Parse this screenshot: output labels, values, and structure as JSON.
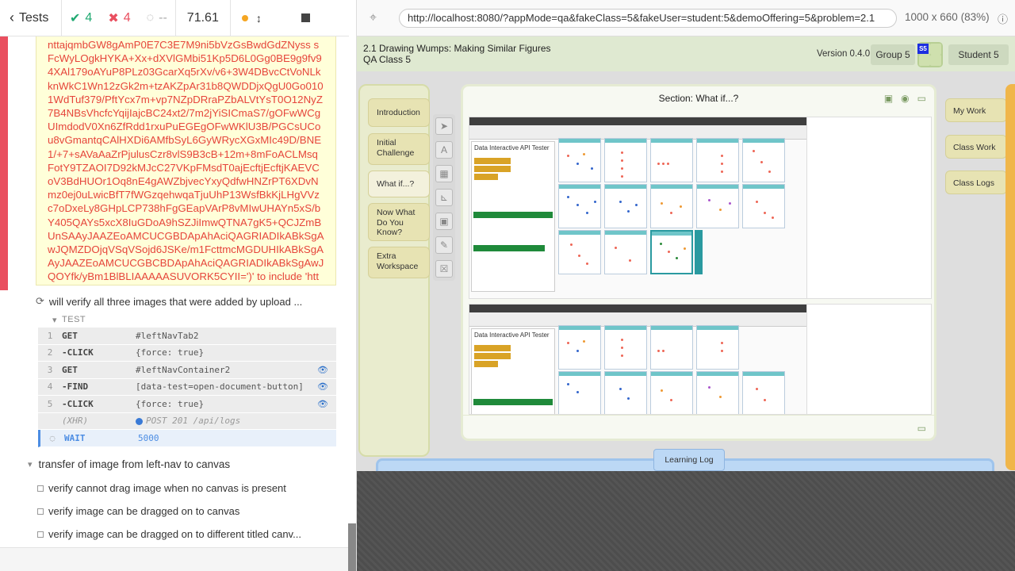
{
  "runner": {
    "tests_label": "Tests",
    "passed": "4",
    "failed": "4",
    "pending": "--",
    "duration": "71.61",
    "error_text": "nttajqmbGW8gAmP0E7C3E7M9ni5bVzGsBwdGdZNyss sFcWyLOgkHYKA+Xx+dXVlGMbi51Kp5D6L0Gg0BE9g9fv94XAl179oAYuP8PLz03GcarXq5rXv/v6+3W4DBvcCtVoNLkknWkC1Wn12zGk2m+tzAKZpAr31b8QWDDjxQgU0Go0101WdTuf379/PftYcx7m+vp7NZpDRraPZbALVtYsT0O12NyZ7B4NBsVhcfcYqijIajcBC24xt2/7m2jYiSICmaS7/gOFwWCgUImdodV0Xn6ZfRdd1rxuPuEGEgOFwWKlU3B/PGCsUCou8vGmantqCAlHXDi6AMfbSyL6GyWRycXGxMIc49D/BNE1/+7+sAVaAaZrPjulusCzr8vlS9B3cB+12m+8mFoACLMsqFotY9TZAOI7D92kMJcC27VKpFMsdT0ajEcftjEcftjKAEVCoV3BdHUOr1Oq8nE4gAWZbjvecYxyQdfwHNZrPT6XDvNmz0ej0uLwicBfT7fWGzqehwqaTjuUhP13WsfBkKjLHgVVzc7oDxeLy8GHpLCP738hFgGEapVArP8vMIwUHAYn5xS/bY405QAYs5xcX8IuGDoA9hSZJiImwQTNA7gK5+QCJZmBUnSAAyJAAZEoAMCUCGBDApAhAciQAGRIADIkABkSgAwJQMZDOjqVSqVSojd6JSKe/m1FcttmcMGDUHIkABkSgAAyJAAZEoAMCUCGBCBDApAhAciQAGRIADIkABkSgAwJQOYfk/yBm1BlBLIAAAAASUVORK5CYII=')' to include 'https://codap.concord.org/~eireland/image.png'",
    "current_test": "will verify all three images that were added by upload ...",
    "test_header": "TEST",
    "commands": [
      {
        "n": "1",
        "name": "GET",
        "msg": "#leftNavTab2"
      },
      {
        "n": "2",
        "name": "-CLICK",
        "msg": "{force: true}"
      },
      {
        "n": "3",
        "name": "GET",
        "msg": "#leftNavContainer2"
      },
      {
        "n": "4",
        "name": "-FIND",
        "msg": "[data-test=open-document-button]"
      },
      {
        "n": "5",
        "name": "-CLICK",
        "msg": "{force: true}"
      },
      {
        "n": "",
        "name": "(XHR)",
        "msg": "POST 201 /api/logs"
      },
      {
        "n": "",
        "name": "WAIT",
        "msg": "5000"
      }
    ],
    "suite_title": "transfer of image from left-nav to canvas",
    "tests": [
      "verify cannot drag image when no canvas is present",
      "verify image can be dragged on to canvas",
      "verify image can be dragged on to different titled canv..."
    ]
  },
  "aut": {
    "url": "http://localhost:8080/?appMode=qa&fakeClass=5&fakeUser=student:5&demoOffering=5&problem=2.1",
    "viewport": "1000 x 660",
    "scale": "(83%)"
  },
  "app": {
    "title_line1": "2.1 Drawing Wumps: Making Similar Figures",
    "title_line2": "QA Class 5",
    "version": "Version 0.4.0",
    "group": "Group 5",
    "badge": "S5",
    "student": "Student 5",
    "left_tabs": [
      "Introduction",
      "Initial Challenge",
      "What if...?",
      "Now What Do You Know?",
      "Extra Workspace"
    ],
    "tools": [
      "pointer-tool",
      "text-tool",
      "table-tool",
      "graph-tool",
      "image-tool",
      "drawing-tool",
      "delete-tool"
    ],
    "section_title": "Section: What if...?",
    "tile_title": "Data Interactive API Tester",
    "right_tabs": [
      "My Work",
      "Class Work",
      "Class Logs"
    ],
    "learning_log": "Learning Log"
  },
  "colors": {
    "pass": "#1fa971",
    "fail": "#e94f5f",
    "accent": "#f5a623"
  }
}
